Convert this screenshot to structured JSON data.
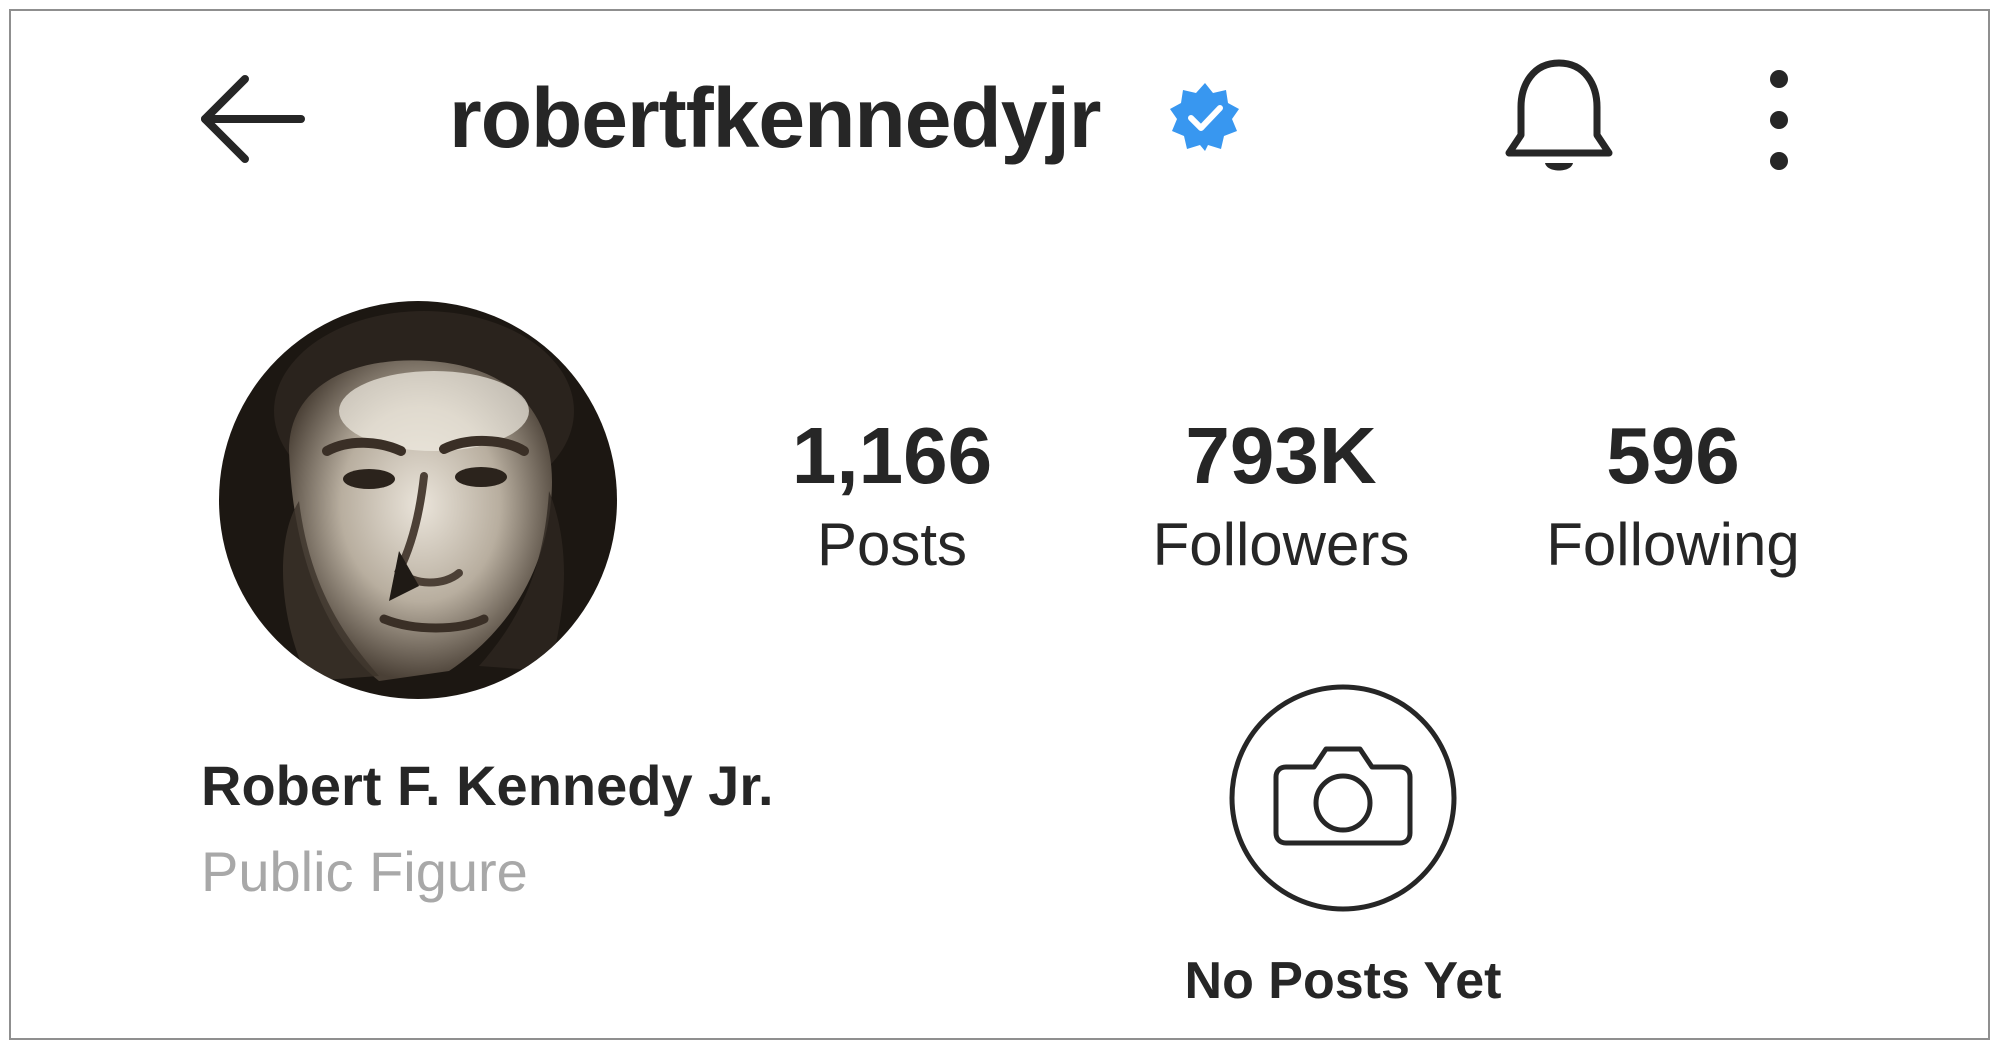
{
  "header": {
    "username": "robertfkennedyjr",
    "verified": true,
    "icons": [
      "back-arrow-icon",
      "verified-badge-icon",
      "bell-icon",
      "more-vertical-icon"
    ]
  },
  "profile": {
    "avatar": "profile-photo",
    "display_name": "Robert F. Kennedy Jr.",
    "category": "Public Figure"
  },
  "stats": {
    "posts": {
      "value": "1,166",
      "label": "Posts"
    },
    "followers": {
      "value": "793K",
      "label": "Followers"
    },
    "following": {
      "value": "596",
      "label": "Following"
    }
  },
  "empty_state": {
    "icon": "camera-icon",
    "text": "No Posts Yet"
  },
  "colors": {
    "text": "#262626",
    "secondary_text": "#a8a8a8",
    "verified_blue": "#3897f0"
  }
}
